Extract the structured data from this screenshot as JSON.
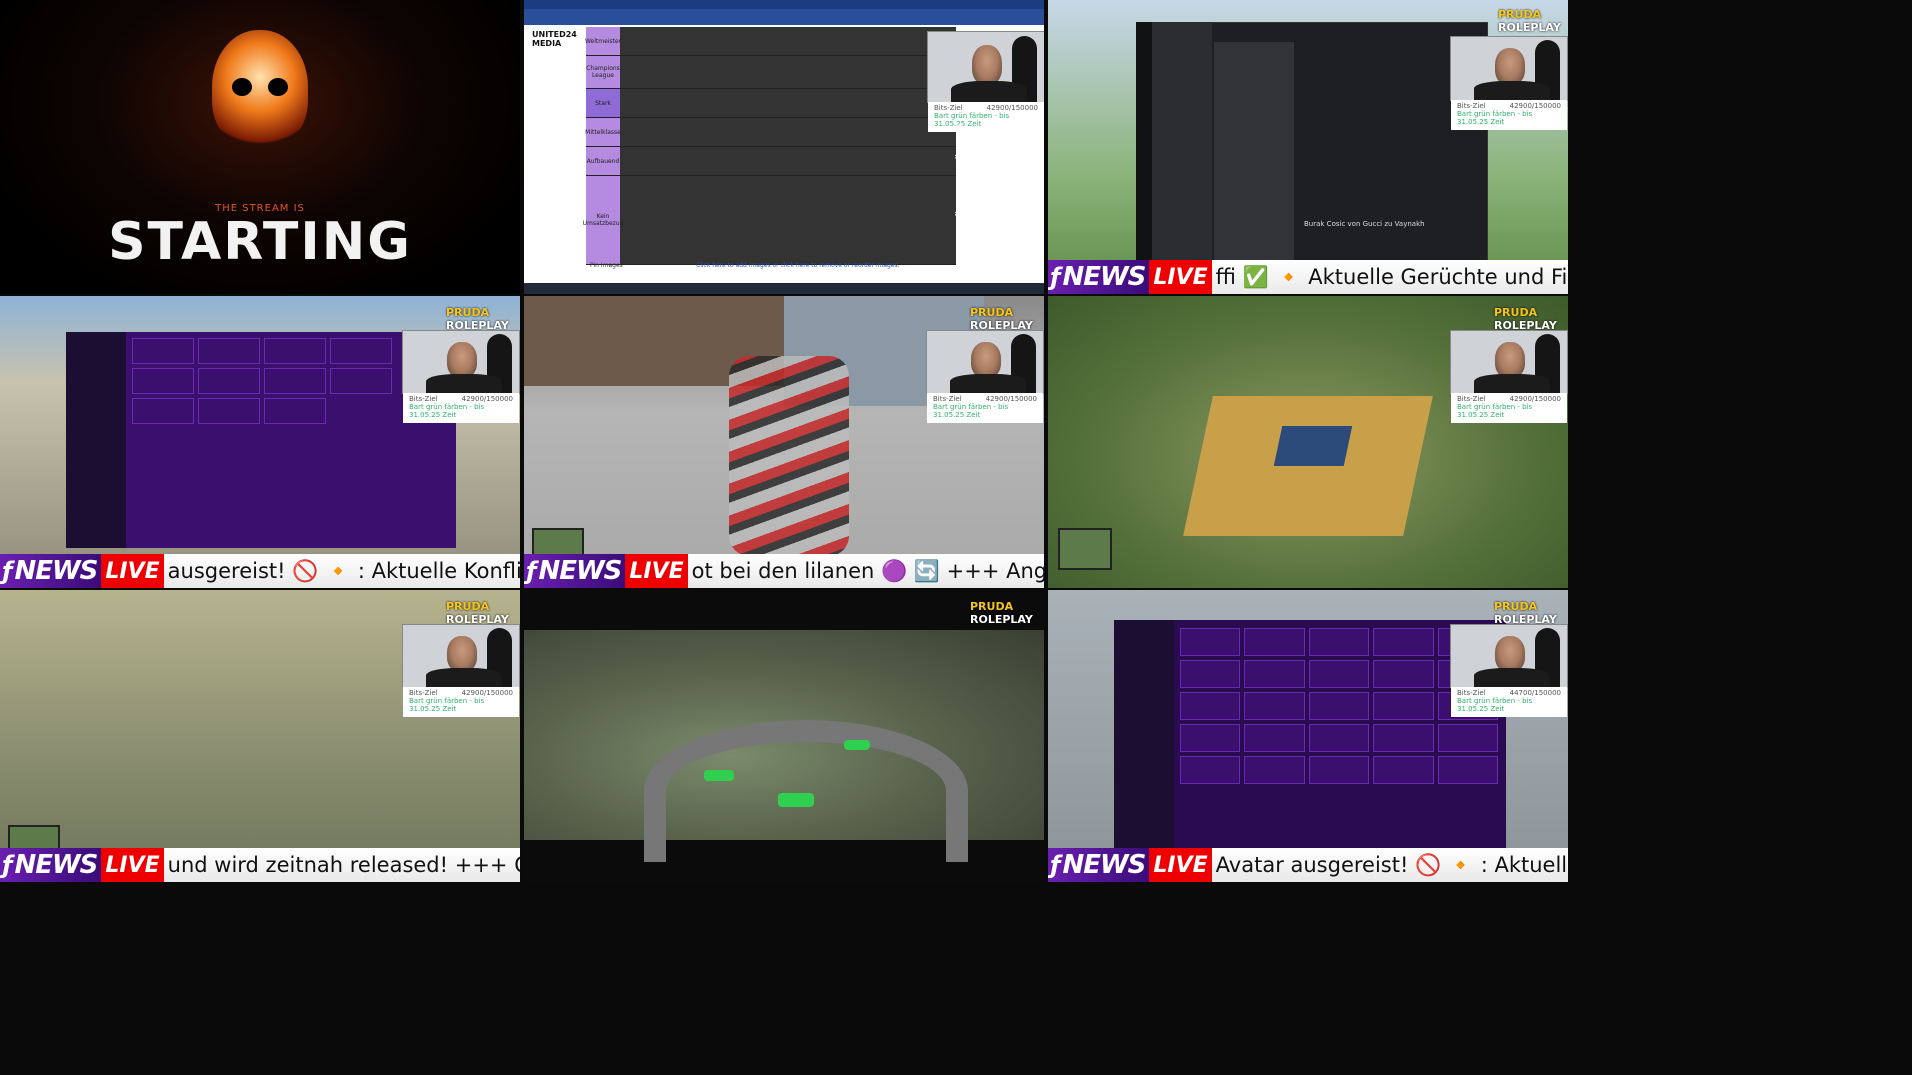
{
  "tiles": {
    "t1": {
      "subtitle": "THE STREAM IS",
      "title": "STARTING"
    },
    "t2": {
      "logo": "UNITED24 MEDIA",
      "tiers": [
        "Weltmeister",
        "Champions League",
        "Stark",
        "Mittelklasse",
        "Aufbauend",
        "Kein Umsatzbezug"
      ],
      "pin_label": "Pin Images",
      "footer_text": "Click here to add images or click here to remove or reorder images."
    },
    "t3": {
      "headline": "Burak Cosic von Gucci zu Vaynakh"
    }
  },
  "brand": {
    "name_a": "PRUDA",
    "name_b": "ROLEPLAY"
  },
  "cam_goal": {
    "label": "Bits-Ziel",
    "value": "42900/150000",
    "sub": "Bart grün färben - bis 31.05.25 Zeit"
  },
  "cam_goal_alt": {
    "value": "44700/150000"
  },
  "tickers": {
    "logo": "NEWS",
    "live": "LIVE",
    "row1_right": "ffi ✅ 🔸 Aktuelle Gerüchte und Fix Transfers 🔄",
    "row2_left": "ausgereist! 🚫 🔸 : Aktuelle Konflikte in der Stadt",
    "row2_mid": "ot bei den lilanen 🟣 🔄 +++ Angebliches Gerüch",
    "row3_left": "und wird zeitnah released! +++ OTF Probewoche",
    "row3_right": "Avatar ausgereist! 🚫 🔸 : Aktuelle Konflikte in d"
  },
  "colors": {
    "accent": "#6a1fb0",
    "live": "#e00000",
    "panel": "#3b0f6e"
  }
}
